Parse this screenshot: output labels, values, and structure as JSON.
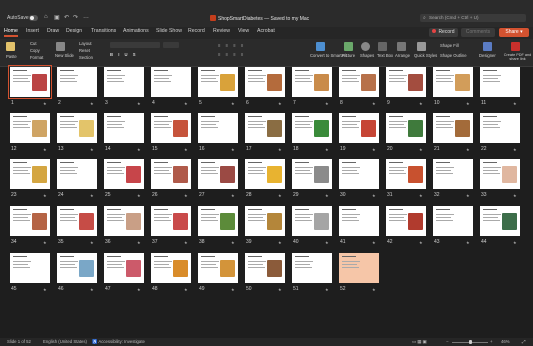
{
  "titlebar": {
    "autosave_label": "AutoSave",
    "document_title": "ShopSmartDiabetes — Saved to my Mac",
    "search_placeholder": "Search (Cmd + Ctrl + U)"
  },
  "tabs": [
    "Home",
    "Insert",
    "Draw",
    "Design",
    "Transitions",
    "Animations",
    "Slide Show",
    "Record",
    "Review",
    "View",
    "Acrobat"
  ],
  "active_tab": "Home",
  "ribbon_buttons": {
    "record": "Record",
    "comments": "Comments",
    "share": "Share"
  },
  "ribbon": {
    "paste": "Paste",
    "cut": "Cut",
    "copy": "Copy",
    "format": "Format",
    "new_slide": "New Slide",
    "layout": "Layout",
    "reset": "Reset",
    "section": "Section",
    "convert_smartart": "Convert to SmartArt",
    "picture": "Picture",
    "shapes": "Shapes",
    "text_box": "Text Box",
    "arrange": "Arrange",
    "quick_styles": "Quick Styles",
    "shape_fill": "Shape Fill",
    "shape_outline": "Shape Outline",
    "designer": "Designer",
    "create_pdf": "Create PDF and share link"
  },
  "slides": [
    {
      "n": "1",
      "starred": true,
      "selected": true,
      "img": "#b44"
    },
    {
      "n": "2",
      "starred": true,
      "img": ""
    },
    {
      "n": "3",
      "starred": true,
      "img": ""
    },
    {
      "n": "4",
      "starred": true,
      "img": ""
    },
    {
      "n": "5",
      "starred": true,
      "img": "#d9a23a"
    },
    {
      "n": "6",
      "starred": true,
      "img": "#b46b3c"
    },
    {
      "n": "7",
      "starred": true,
      "img": "#c98b4a"
    },
    {
      "n": "8",
      "starred": true,
      "img": "#b7714a"
    },
    {
      "n": "9",
      "starred": true,
      "img": "#a34d3f"
    },
    {
      "n": "10",
      "starred": true,
      "img": "#d29d5a"
    },
    {
      "n": "11",
      "starred": true,
      "img": ""
    },
    {
      "n": "12",
      "starred": true,
      "img": "#cfa464"
    },
    {
      "n": "13",
      "starred": true,
      "img": "#e3c46a"
    },
    {
      "n": "14",
      "starred": true,
      "img": ""
    },
    {
      "n": "15",
      "starred": true,
      "img": "#c6543c"
    },
    {
      "n": "16",
      "starred": true,
      "img": ""
    },
    {
      "n": "17",
      "starred": true,
      "img": "#8a6d43"
    },
    {
      "n": "18",
      "starred": true,
      "img": "#3a8b3a"
    },
    {
      "n": "19",
      "starred": true,
      "img": "#c64535"
    },
    {
      "n": "20",
      "starred": true,
      "img": "#3f7a3c"
    },
    {
      "n": "21",
      "starred": true,
      "img": "#a36b3a"
    },
    {
      "n": "22",
      "starred": true,
      "img": ""
    },
    {
      "n": "23",
      "starred": true,
      "img": "#d4a642"
    },
    {
      "n": "24",
      "starred": true,
      "img": ""
    },
    {
      "n": "25",
      "starred": true,
      "img": "#c7454a"
    },
    {
      "n": "26",
      "starred": true,
      "img": "#b05a4a"
    },
    {
      "n": "27",
      "starred": true,
      "img": "#9b4a44"
    },
    {
      "n": "28",
      "starred": true,
      "img": "#e8b330"
    },
    {
      "n": "29",
      "starred": true,
      "img": "#8b8b8b"
    },
    {
      "n": "30",
      "starred": true,
      "img": ""
    },
    {
      "n": "31",
      "starred": true,
      "img": "#c8512f"
    },
    {
      "n": "32",
      "starred": true,
      "img": ""
    },
    {
      "n": "33",
      "starred": true,
      "img": "#e0b7a0"
    },
    {
      "n": "34",
      "starred": true,
      "img": "#b56445"
    },
    {
      "n": "35",
      "starred": true,
      "img": "#c64c46"
    },
    {
      "n": "36",
      "starred": true,
      "img": "#c99f86"
    },
    {
      "n": "37",
      "starred": true,
      "img": "#c94a4a"
    },
    {
      "n": "38",
      "starred": true,
      "img": "#5c8b3a"
    },
    {
      "n": "39",
      "starred": true,
      "img": "#b4863a"
    },
    {
      "n": "40",
      "starred": true,
      "img": "#a5a5a5"
    },
    {
      "n": "41",
      "starred": true,
      "img": ""
    },
    {
      "n": "42",
      "starred": true,
      "img": "#b13b2e"
    },
    {
      "n": "43",
      "starred": true,
      "img": ""
    },
    {
      "n": "44",
      "starred": true,
      "img": "#3d6e4a"
    },
    {
      "n": "45",
      "starred": true,
      "img": ""
    },
    {
      "n": "46",
      "starred": true,
      "img": "#7aa7c7"
    },
    {
      "n": "47",
      "starred": true,
      "img": "#cc5a6a"
    },
    {
      "n": "48",
      "starred": true,
      "img": "#d98c2a"
    },
    {
      "n": "49",
      "starred": true,
      "img": "#d3943a"
    },
    {
      "n": "50",
      "starred": true,
      "img": "#8b5b3a"
    },
    {
      "n": "51",
      "starred": true,
      "img": ""
    },
    {
      "n": "52",
      "starred": true,
      "img": "",
      "peach": true
    }
  ],
  "statusbar": {
    "slide_count": "Slide 1 of 52",
    "language": "English (United States)",
    "accessibility": "Accessibility: Investigate",
    "zoom": "46%"
  },
  "colors": {
    "accent": "#d35230",
    "background": "#1e1e1e"
  }
}
